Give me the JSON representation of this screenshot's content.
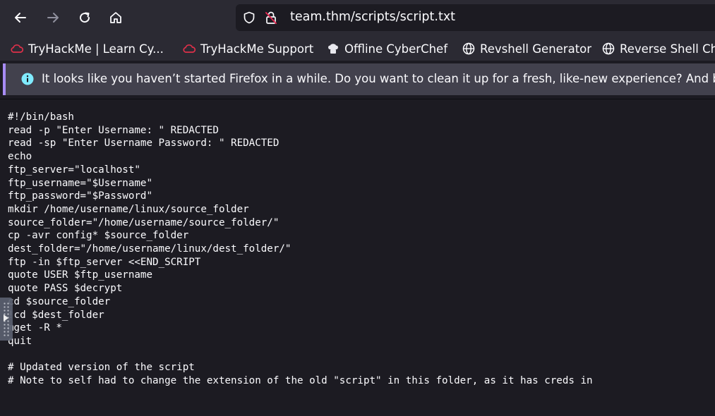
{
  "browser": {
    "url": "team.thm/scripts/script.txt",
    "bookmarks": [
      {
        "label": "TryHackMe | Learn Cy...",
        "icon": "tryhackme-cloud-icon"
      },
      {
        "label": "TryHackMe Support",
        "icon": "tryhackme-cloud-icon"
      },
      {
        "label": "Offline CyberChef",
        "icon": "chef-hat-icon"
      },
      {
        "label": "Revshell Generator",
        "icon": "globe-icon"
      },
      {
        "label": "Reverse Shell Ch",
        "icon": "globe-icon"
      }
    ],
    "notification": "It looks like you haven’t started Firefox in a while. Do you want to clean it up for a fresh, like-new experience? And by"
  },
  "script": {
    "lines": [
      "#!/bin/bash",
      "read -p \"Enter Username: \" REDACTED",
      "read -sp \"Enter Username Password: \" REDACTED",
      "echo",
      "ftp_server=\"localhost\"",
      "ftp_username=\"$Username\"",
      "ftp_password=\"$Password\"",
      "mkdir /home/username/linux/source_folder",
      "source_folder=\"/home/username/source_folder/\"",
      "cp -avr config* $source_folder",
      "dest_folder=\"/home/username/linux/dest_folder/\"",
      "ftp -in $ftp_server <<END_SCRIPT",
      "quote USER $ftp_username",
      "quote PASS $decrypt",
      "cd $source_folder",
      "!cd $dest_folder",
      "mget -R *",
      "quit",
      "",
      "# Updated version of the script",
      "# Note to self had to change the extension of the old \"script\" in this folder, as it has creds in"
    ]
  },
  "colors": {
    "toolbar": "#2b2a33",
    "page": "#1c1b22",
    "accent": "#a88cf5",
    "tryhackme": "#e0304a"
  }
}
